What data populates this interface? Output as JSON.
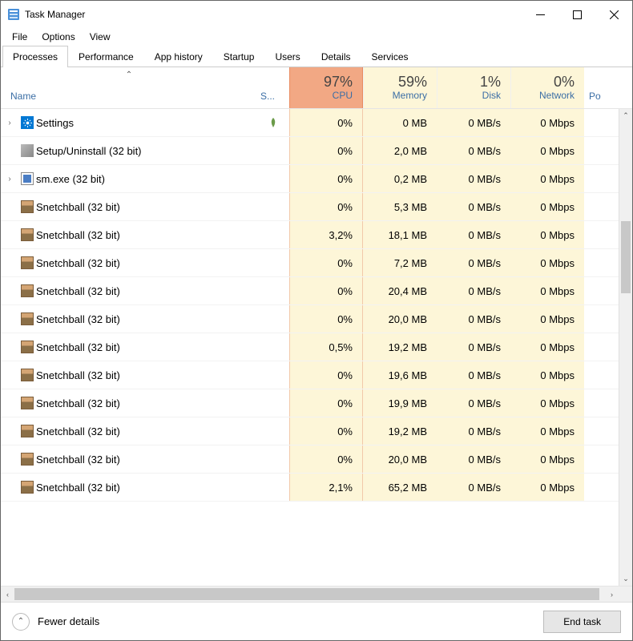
{
  "window": {
    "title": "Task Manager"
  },
  "menubar": [
    "File",
    "Options",
    "View"
  ],
  "tabs": [
    "Processes",
    "Performance",
    "App history",
    "Startup",
    "Users",
    "Details",
    "Services"
  ],
  "activeTab": 0,
  "headers": {
    "name": "Name",
    "status": "S...",
    "cpu": {
      "pct": "97%",
      "label": "CPU"
    },
    "memory": {
      "pct": "59%",
      "label": "Memory"
    },
    "disk": {
      "pct": "1%",
      "label": "Disk"
    },
    "network": {
      "pct": "0%",
      "label": "Network"
    },
    "last": "Po"
  },
  "processes": [
    {
      "expandable": true,
      "icon": "settings",
      "name": "Settings",
      "status": "leaf",
      "cpu": "0%",
      "mem": "0 MB",
      "disk": "0 MB/s",
      "net": "0 Mbps"
    },
    {
      "expandable": false,
      "icon": "tools",
      "name": "Setup/Uninstall (32 bit)",
      "cpu": "0%",
      "mem": "2,0 MB",
      "disk": "0 MB/s",
      "net": "0 Mbps"
    },
    {
      "expandable": true,
      "icon": "sm",
      "name": "sm.exe (32 bit)",
      "cpu": "0%",
      "mem": "0,2 MB",
      "disk": "0 MB/s",
      "net": "0 Mbps"
    },
    {
      "expandable": false,
      "icon": "snetch",
      "name": "Snetchball (32 bit)",
      "cpu": "0%",
      "mem": "5,3 MB",
      "disk": "0 MB/s",
      "net": "0 Mbps"
    },
    {
      "expandable": false,
      "icon": "snetch",
      "name": "Snetchball (32 bit)",
      "cpu": "3,2%",
      "mem": "18,1 MB",
      "disk": "0 MB/s",
      "net": "0 Mbps"
    },
    {
      "expandable": false,
      "icon": "snetch",
      "name": "Snetchball (32 bit)",
      "cpu": "0%",
      "mem": "7,2 MB",
      "disk": "0 MB/s",
      "net": "0 Mbps"
    },
    {
      "expandable": false,
      "icon": "snetch",
      "name": "Snetchball (32 bit)",
      "cpu": "0%",
      "mem": "20,4 MB",
      "disk": "0 MB/s",
      "net": "0 Mbps"
    },
    {
      "expandable": false,
      "icon": "snetch",
      "name": "Snetchball (32 bit)",
      "cpu": "0%",
      "mem": "20,0 MB",
      "disk": "0 MB/s",
      "net": "0 Mbps"
    },
    {
      "expandable": false,
      "icon": "snetch",
      "name": "Snetchball (32 bit)",
      "cpu": "0,5%",
      "mem": "19,2 MB",
      "disk": "0 MB/s",
      "net": "0 Mbps"
    },
    {
      "expandable": false,
      "icon": "snetch",
      "name": "Snetchball (32 bit)",
      "cpu": "0%",
      "mem": "19,6 MB",
      "disk": "0 MB/s",
      "net": "0 Mbps"
    },
    {
      "expandable": false,
      "icon": "snetch",
      "name": "Snetchball (32 bit)",
      "cpu": "0%",
      "mem": "19,9 MB",
      "disk": "0 MB/s",
      "net": "0 Mbps"
    },
    {
      "expandable": false,
      "icon": "snetch",
      "name": "Snetchball (32 bit)",
      "cpu": "0%",
      "mem": "19,2 MB",
      "disk": "0 MB/s",
      "net": "0 Mbps"
    },
    {
      "expandable": false,
      "icon": "snetch",
      "name": "Snetchball (32 bit)",
      "cpu": "0%",
      "mem": "20,0 MB",
      "disk": "0 MB/s",
      "net": "0 Mbps"
    },
    {
      "expandable": false,
      "icon": "snetch",
      "name": "Snetchball (32 bit)",
      "cpu": "2,1%",
      "mem": "65,2 MB",
      "disk": "0 MB/s",
      "net": "0 Mbps"
    }
  ],
  "footer": {
    "fewer": "Fewer details",
    "endTask": "End task"
  }
}
